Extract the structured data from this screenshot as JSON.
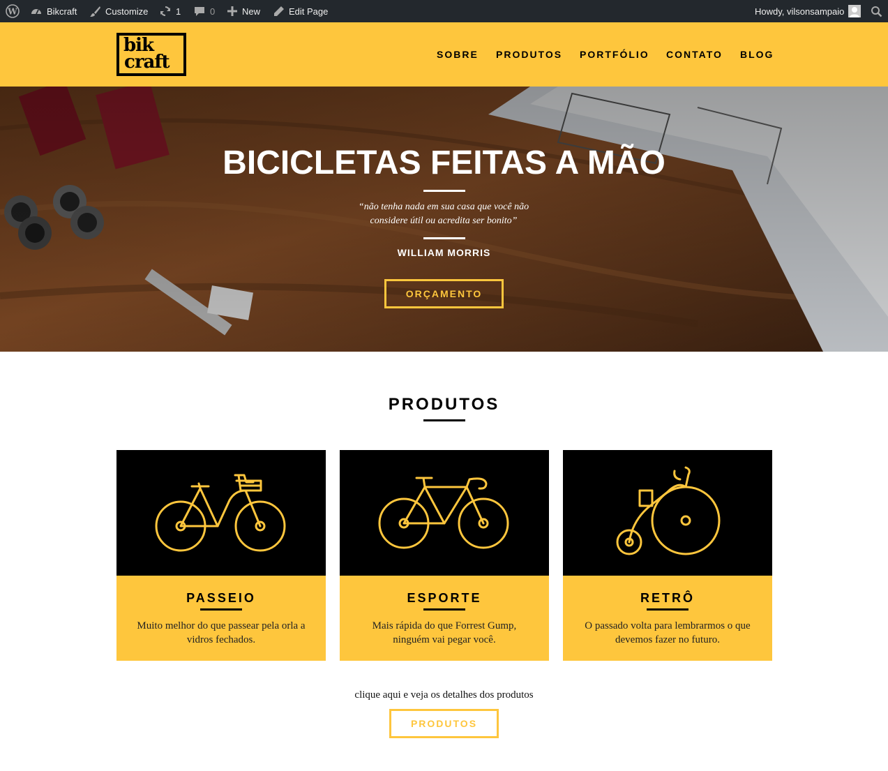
{
  "admin_bar": {
    "site_name": "Bikcraft",
    "customize": "Customize",
    "updates_count": "1",
    "comments_count": "0",
    "new_label": "New",
    "edit_page": "Edit Page",
    "howdy": "Howdy, vilsonsampaio"
  },
  "header": {
    "logo_line1": "bik",
    "logo_line2": "craft",
    "nav": [
      "SOBRE",
      "PRODUTOS",
      "PORTFÓLIO",
      "CONTATO",
      "BLOG"
    ]
  },
  "hero": {
    "title": "BICICLETAS FEITAS A MÃO",
    "quote_line1": "“não tenha nada em sua casa que você não",
    "quote_line2": "considere útil ou acredita ser bonito”",
    "author": "WILLIAM MORRIS",
    "button": "ORÇAMENTO"
  },
  "products": {
    "title": "PRODUTOS",
    "items": [
      {
        "title": "PASSEIO",
        "text": "Muito melhor do que passear pela orla a vidros fechados.",
        "icon": "city-bike-icon"
      },
      {
        "title": "ESPORTE",
        "text": "Mais rápida do que Forrest Gump, ninguém vai pegar você.",
        "icon": "sport-bike-icon"
      },
      {
        "title": "RETRÔ",
        "text": "O passado volta para lembrarmos o que devemos fazer no futuro.",
        "icon": "penny-farthing-icon"
      }
    ],
    "cta_text": "clique aqui e veja os detalhes dos produtos",
    "cta_button": "PRODUTOS"
  },
  "colors": {
    "brand_yellow": "#fec63d",
    "admin_bar": "#23282d",
    "black": "#000000"
  }
}
